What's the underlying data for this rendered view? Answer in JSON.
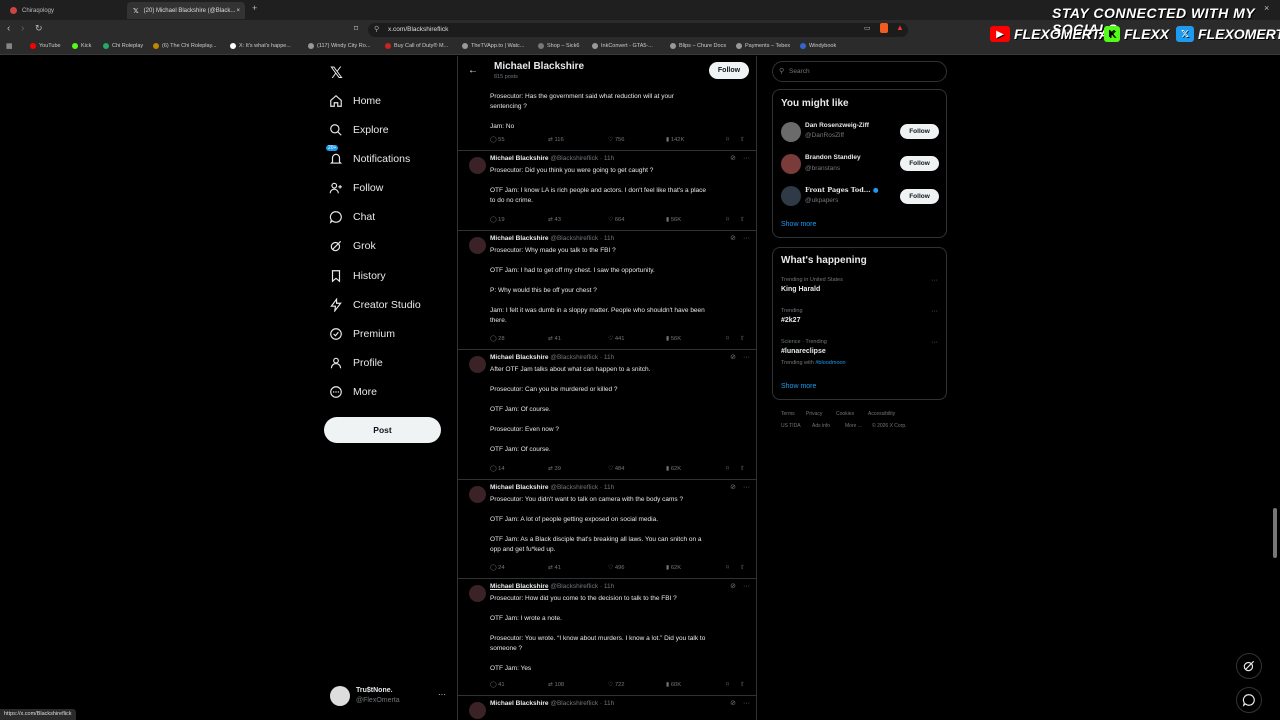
{
  "browser": {
    "tabs": [
      {
        "title": "Chiraqology"
      },
      {
        "title": "(20) Michael Blackshire (@Black..."
      }
    ],
    "url": "x.com/Blackshireflick",
    "bookmarks": [
      "YouTube",
      "Kick",
      "Chi Roleplay",
      "(6) The Chi Roleplay...",
      "X: It's what's happe...",
      "(117) Windy City Ro...",
      "Buy Call of Duty® M...",
      "TheTVApp.to | Watc...",
      "Shop – Sick6",
      "InkConvert - GTA5-...",
      "Blips – Chure Docs",
      "Payments – Tebex",
      "Windybook"
    ],
    "status_url": "https://x.com/Blackshireflick"
  },
  "overlay": {
    "title": "STAY CONNECTED WITH MY SOCIALS",
    "youtube": "FLEXOMERTA",
    "kick": "FLEXX",
    "x": "FLEXOMERTA"
  },
  "nav": {
    "items": [
      "Home",
      "Explore",
      "Notifications",
      "Follow",
      "Chat",
      "Grok",
      "History",
      "Creator Studio",
      "Premium",
      "Profile",
      "More"
    ],
    "notif_badge": "20+",
    "post_label": "Post",
    "account_name": "Tru$tNone.",
    "account_handle": "@FlexOmerta"
  },
  "profile": {
    "name": "Michael Blackshire",
    "posts": "815 posts",
    "follow_label": "Follow"
  },
  "tweets": [
    {
      "name": "",
      "handle": "",
      "lines": [
        "Prosecutor: Has the government said what reduction will at your",
        "sentencing ?",
        "",
        "Jam: No"
      ],
      "replies": "55",
      "reposts": "116",
      "likes": "756",
      "views": "142K"
    },
    {
      "name": "Michael Blackshire",
      "handle": "@Blackshireflick · 11h",
      "lines": [
        "Prosecutor: Did you think you were going to get caught ?",
        "",
        "OTF Jam: I know LA is rich people and actors. I don't feel like that's a place",
        "to do no crime."
      ],
      "replies": "19",
      "reposts": "43",
      "likes": "664",
      "views": "56K"
    },
    {
      "name": "Michael Blackshire",
      "handle": "@Blackshireflick · 11h",
      "lines": [
        "Prosecutor: Why made you talk to the FBI ?",
        "",
        "OTF Jam: I had to get off my chest. I saw the opportunity.",
        "",
        "P: Why would this be off your chest ?",
        "",
        "Jam: I felt it was dumb in a sloppy matter. People who shouldn't have been",
        "there."
      ],
      "replies": "28",
      "reposts": "41",
      "likes": "441",
      "views": "56K"
    },
    {
      "name": "Michael Blackshire",
      "handle": "@Blackshireflick · 11h",
      "lines": [
        "After OTF Jam talks about what can happen to a snitch.",
        "",
        "Prosecutor: Can you be murdered or killed ?",
        "",
        "OTF Jam: Of course.",
        "",
        "Prosecutor: Even now ?",
        "",
        "OTF Jam: Of course."
      ],
      "replies": "14",
      "reposts": "39",
      "likes": "484",
      "views": "62K"
    },
    {
      "name": "Michael Blackshire",
      "handle": "@Blackshireflick · 11h",
      "lines": [
        "Prosecutor: You didn't want to talk on camera with the body cams ?",
        "",
        "OTF Jam: A lot of people getting exposed on social media.",
        "",
        "OTF Jam: As a Black disciple that's breaking all laws. You can snitch on a",
        "opp and get fu*ked up."
      ],
      "replies": "24",
      "reposts": "41",
      "likes": "496",
      "views": "62K"
    },
    {
      "name": "Michael Blackshire",
      "handle": "@Blackshireflick · 11h",
      "lines": [
        "Prosecutor: How did you come to the decision to talk to the FBI ?",
        "",
        "OTF Jam: I wrote a note.",
        "",
        "Prosecutor: You wrote. “I know about murders. I know a lot.” Did you talk to",
        "someone ?",
        "",
        "OTF Jam: Yes"
      ],
      "replies": "41",
      "reposts": "108",
      "likes": "722",
      "views": "60K"
    },
    {
      "name": "Michael Blackshire",
      "handle": "@Blackshireflick · 11h",
      "lines": [],
      "replies": "",
      "reposts": "",
      "likes": "",
      "views": ""
    }
  ],
  "right": {
    "search_placeholder": "Search",
    "might_like_title": "You might like",
    "suggestions": [
      {
        "name": "Dan Rosenzweig-Ziff",
        "handle": "@DanRosZiff"
      },
      {
        "name": "Brandon Standley",
        "handle": "@branstans"
      },
      {
        "name": "Front Pages Tod...",
        "handle": "@ukpapers"
      }
    ],
    "follow_label": "Follow",
    "show_more": "Show more",
    "happening_title": "What's happening",
    "trends": [
      {
        "meta": "Trending in United States",
        "name": "King Harald",
        "extra": ""
      },
      {
        "meta": "Trending",
        "name": "#2k27",
        "extra": ""
      },
      {
        "meta": "Science · Trending",
        "name": "#lunareclipse",
        "extra_prefix": "Trending with ",
        "extra": "#bloodmoon"
      }
    ],
    "footer": [
      "Terms",
      "Privacy",
      "Cookies",
      "Accessibility",
      "US TIDA",
      "Ads info",
      "More ...",
      "© 2026 X Corp."
    ]
  },
  "colors": {
    "accent": "#1d9bf0",
    "background": "#000000",
    "border": "#2f3336",
    "muted": "#71767b",
    "youtube_red": "#ff0000",
    "kick_green": "#53fc18"
  }
}
